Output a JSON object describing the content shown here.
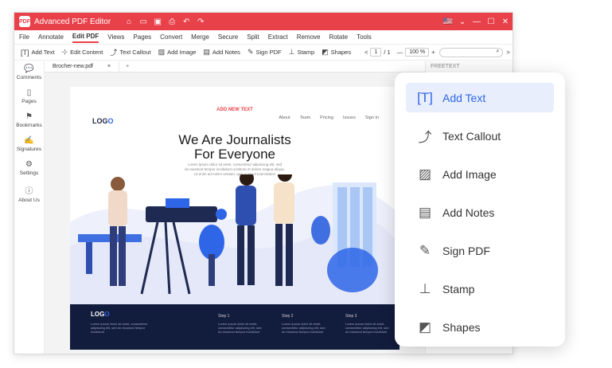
{
  "titlebar": {
    "app_title": "Advanced PDF Editor",
    "lang_flag": "🇺🇸"
  },
  "menubar": {
    "items": [
      "File",
      "Annotate",
      "Edit PDF",
      "Views",
      "Pages",
      "Convert",
      "Merge",
      "Secure",
      "Split",
      "Extract",
      "Remove",
      "Rotate",
      "Tools"
    ],
    "active": "Edit PDF"
  },
  "toolbar": {
    "tools": [
      "Add Text",
      "Edit Content",
      "Text Callout",
      "Add Image",
      "Add Notes",
      "Sign PDF",
      "Stamp",
      "Shapes"
    ],
    "page_current": "1",
    "page_total": "/ 1",
    "zoom": "100 %",
    "zoom_in": "+",
    "zoom_out": "—",
    "prev": "<",
    "next": ">"
  },
  "leftnav": {
    "items": [
      {
        "label": "Comments",
        "icon": "comments-icon"
      },
      {
        "label": "Pages",
        "icon": "pages-icon"
      },
      {
        "label": "Bookmarks",
        "icon": "bookmark-icon"
      },
      {
        "label": "Signatures",
        "icon": "signature-icon"
      },
      {
        "label": "Settings",
        "icon": "gear-icon"
      },
      {
        "label": "About Us",
        "icon": "info-icon"
      }
    ]
  },
  "tabs": {
    "file_tab": "Brocher-new.pdf",
    "close": "×",
    "plus": "+"
  },
  "rightpane": {
    "header": "FREETEXT"
  },
  "page": {
    "logo_text": "LOG",
    "logo_accent": "O",
    "add_new_text": "ADD NEW TEXT",
    "nav": [
      "About",
      "Team",
      "Pricing",
      "Issues",
      "Sign In"
    ],
    "headline_1": "We Are Journalists",
    "headline_2": "For Everyone",
    "lorem_1": "Lorem ipsum dolor sit amet, consectetur adipiscing elit, sed",
    "lorem_2": "do eiusmod tempor incididunt ut labore et dolore magna aliqua.",
    "lorem_3": "Ut enim ad minim veniam, quis nostrud exercitation",
    "footer": {
      "step1": "Step 1",
      "step2": "Step 2",
      "step3": "Step 3",
      "body": "Lorem ipsum dolor sit amet, consectetur adipiscing elit, sed do eiusmod tempor incididunt"
    }
  },
  "popup": {
    "items": [
      {
        "label": "Add Text",
        "icon": "add-text-icon"
      },
      {
        "label": "Text Callout",
        "icon": "text-callout-icon"
      },
      {
        "label": "Add Image",
        "icon": "add-image-icon"
      },
      {
        "label": "Add Notes",
        "icon": "add-notes-icon"
      },
      {
        "label": "Sign PDF",
        "icon": "sign-pdf-icon"
      },
      {
        "label": "Stamp",
        "icon": "stamp-icon"
      },
      {
        "label": "Shapes",
        "icon": "shapes-icon"
      }
    ],
    "active": "Add Text"
  },
  "colors": {
    "brand_red": "#e9414a",
    "accent_blue": "#2f66e8",
    "footer_navy": "#121c3d"
  }
}
